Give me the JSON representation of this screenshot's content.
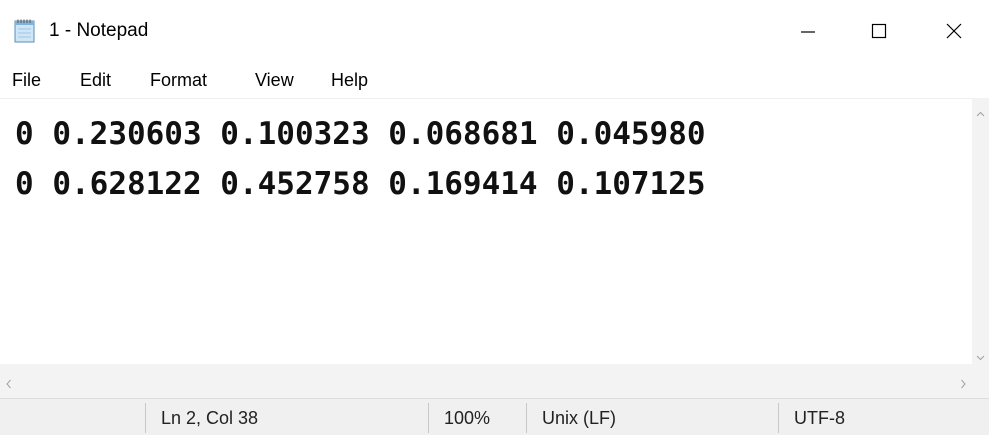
{
  "window": {
    "title": "1 - Notepad",
    "icon": "notepad-icon"
  },
  "title_buttons": {
    "minimize_icon": "minimize-icon",
    "maximize_icon": "maximize-icon",
    "close_icon": "close-icon"
  },
  "menu": {
    "items": [
      "File",
      "Edit",
      "Format",
      "View",
      "Help"
    ]
  },
  "editor": {
    "lines": [
      "0 0.230603 0.100323 0.068681 0.045980",
      "0 0.628122 0.452758 0.169414 0.107125"
    ]
  },
  "scrollbars": {
    "vertical_icons": [
      "chevron-up-icon",
      "chevron-down-icon"
    ],
    "horizontal_icons": [
      "chevron-left-icon",
      "chevron-right-icon"
    ]
  },
  "status_bar": {
    "position": "Ln 2, Col 38",
    "zoom": "100%",
    "line_ending": "Unix (LF)",
    "encoding": "UTF-8"
  },
  "colors": {
    "status_bar_bg": "#f0f0f0",
    "scrollbar_bg": "#f3f3f3",
    "text": "#111111"
  }
}
